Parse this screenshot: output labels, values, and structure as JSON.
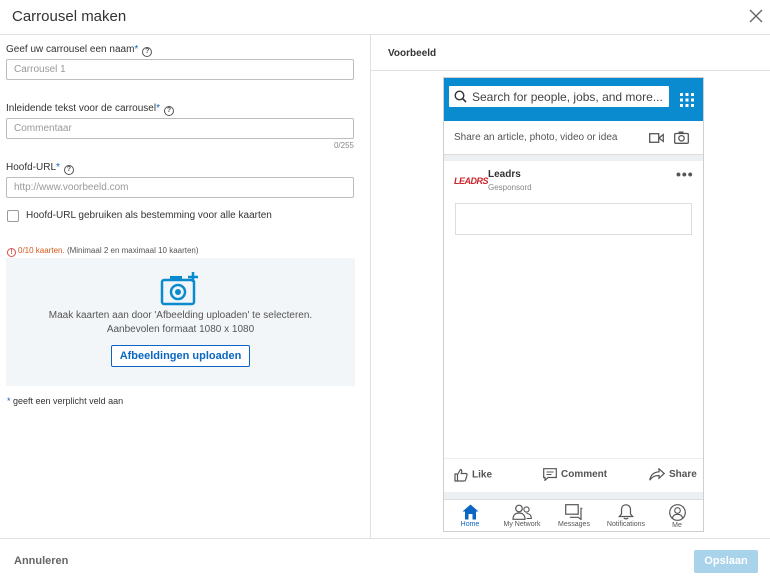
{
  "dialog": {
    "title": "Carrousel maken"
  },
  "form": {
    "name_label": "Geef uw carrousel een naam",
    "name_required": "*",
    "name_placeholder": "Carrousel 1",
    "intro_label": "Inleidende tekst voor de carrousel",
    "intro_required": "*",
    "intro_placeholder": "Commentaar",
    "intro_counter": "0/255",
    "url_label": "Hoofd-URL",
    "url_required": "*",
    "url_placeholder": "http://www.voorbeeld.com",
    "checkbox_label": "Hoofd-URL gebruiken als bestemming voor alle kaarten",
    "cards_count": "0/10 kaarten.",
    "cards_hint": "(Minimaal 2 en maximaal 10 kaarten)",
    "upload_text1": "Maak kaarten aan door 'Afbeelding uploaden' te selecteren.",
    "upload_text2": "Aanbevolen formaat 1080 x 1080",
    "upload_button": "Afbeeldingen uploaden",
    "footnote_star": "*",
    "footnote_text": " geeft een verplicht veld aan"
  },
  "preview": {
    "label": "Voorbeeld",
    "search_placeholder": "Search for people, jobs, and more...",
    "share_text": "Share an article, photo, video or idea",
    "post": {
      "logo": "LEADRS",
      "company": "Leadrs",
      "sponsored": "Gesponsord",
      "more": "•••"
    },
    "actions": {
      "like": "Like",
      "comment": "Comment",
      "share": "Share"
    },
    "nav": [
      {
        "label": "Home",
        "icon": "home-icon"
      },
      {
        "label": "My Network",
        "icon": "network-icon"
      },
      {
        "label": "Messages",
        "icon": "messages-icon"
      },
      {
        "label": "Notifications",
        "icon": "bell-icon"
      },
      {
        "label": "Me",
        "icon": "profile-icon"
      }
    ]
  },
  "footer": {
    "cancel": "Annuleren",
    "save": "Opslaan"
  },
  "colors": {
    "accent": "#0a66c2",
    "phone_header": "#0a8bcf",
    "warning": "#d25a1b",
    "save_disabled": "#a9d3ea"
  }
}
